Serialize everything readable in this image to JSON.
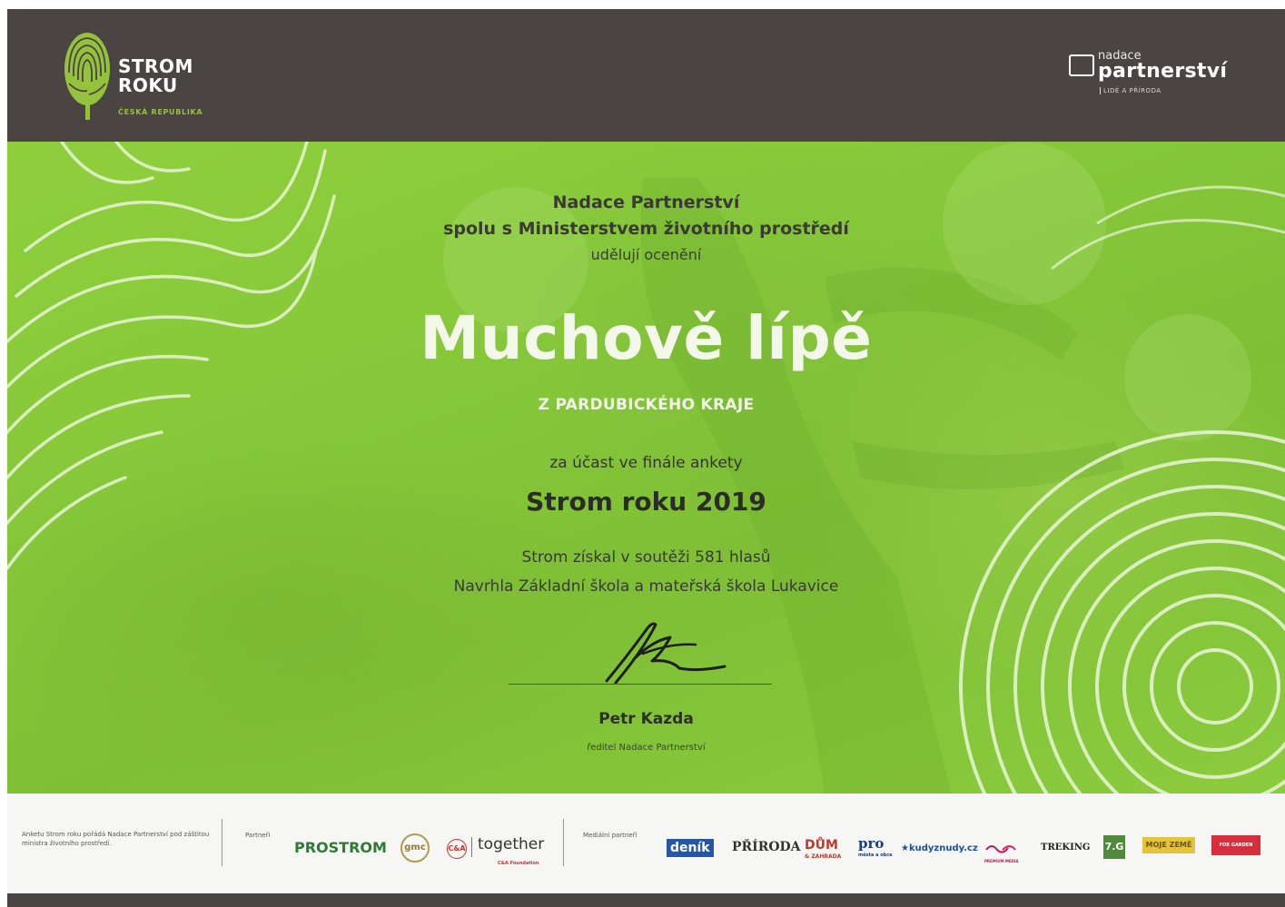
{
  "header": {
    "brand_line1": "STROM",
    "brand_line2": "ROKU",
    "brand_sub": "ČESKÁ REPUBLIKA",
    "np_small": "nadace",
    "np_big": "partnerství",
    "np_tag": "LIDÉ A PŘÍRODA"
  },
  "certificate": {
    "org_line1": "Nadace Partnerství",
    "org_line2": "spolu s Ministerstvem životního prostředí",
    "award_text": "udělují ocenění",
    "tree_name": "Muchově lípě",
    "region": "Z PARDUBICKÉHO KRAJE",
    "participation": "za účast ve finále ankety",
    "contest": "Strom roku 2019",
    "votes": "Strom získal v soutěži 581 hlasů",
    "nominated_by": "Navrhla Základní škola a mateřská škola Lukavice",
    "signer_name": "Petr Kazda",
    "signer_role": "ředitel Nadace Partnerství"
  },
  "footer": {
    "note": "Anketu Strom roku pořádá Nadace Partnerství pod záštitou ministra životního prostředí.",
    "partners_label": "Partneři",
    "media_label": "Mediální partneři",
    "partners": [
      {
        "name": "PROSTROM",
        "color": "#2f7a34"
      },
      {
        "name": "gmc",
        "color": "#9a7b2e"
      },
      {
        "name": "C&A",
        "color": "#d0322d"
      },
      {
        "name": "together",
        "color": "#333333"
      },
      {
        "name": "C&A Foundation",
        "color": "#d0322d"
      }
    ],
    "media": [
      {
        "name": "deník",
        "color": "#2457a5"
      },
      {
        "name": "PŘÍRODA",
        "color": "#333333"
      },
      {
        "name": "DŮM",
        "color": "#c0392b"
      },
      {
        "name": "& ZAHRADA",
        "color": "#c0392b"
      },
      {
        "name": "pro",
        "color": "#1c3e7a"
      },
      {
        "name": "města a obce",
        "color": "#1c3e7a"
      },
      {
        "name": "kudyznudy.cz",
        "color": "#1d4f9c"
      },
      {
        "name": "PREMIUM MEDIA",
        "color": "#c2185b"
      },
      {
        "name": "TREKING",
        "color": "#222222"
      },
      {
        "name": "7.G",
        "color": "#4f8a3b"
      },
      {
        "name": "MOJE ZEMĚ",
        "color": "#a08316"
      },
      {
        "name": "FOR GARDEN",
        "color": "#d62e3c"
      }
    ]
  },
  "colors": {
    "header_bg": "#4a4443",
    "accent_green": "#95c23d",
    "body_green": "#86c83a"
  }
}
